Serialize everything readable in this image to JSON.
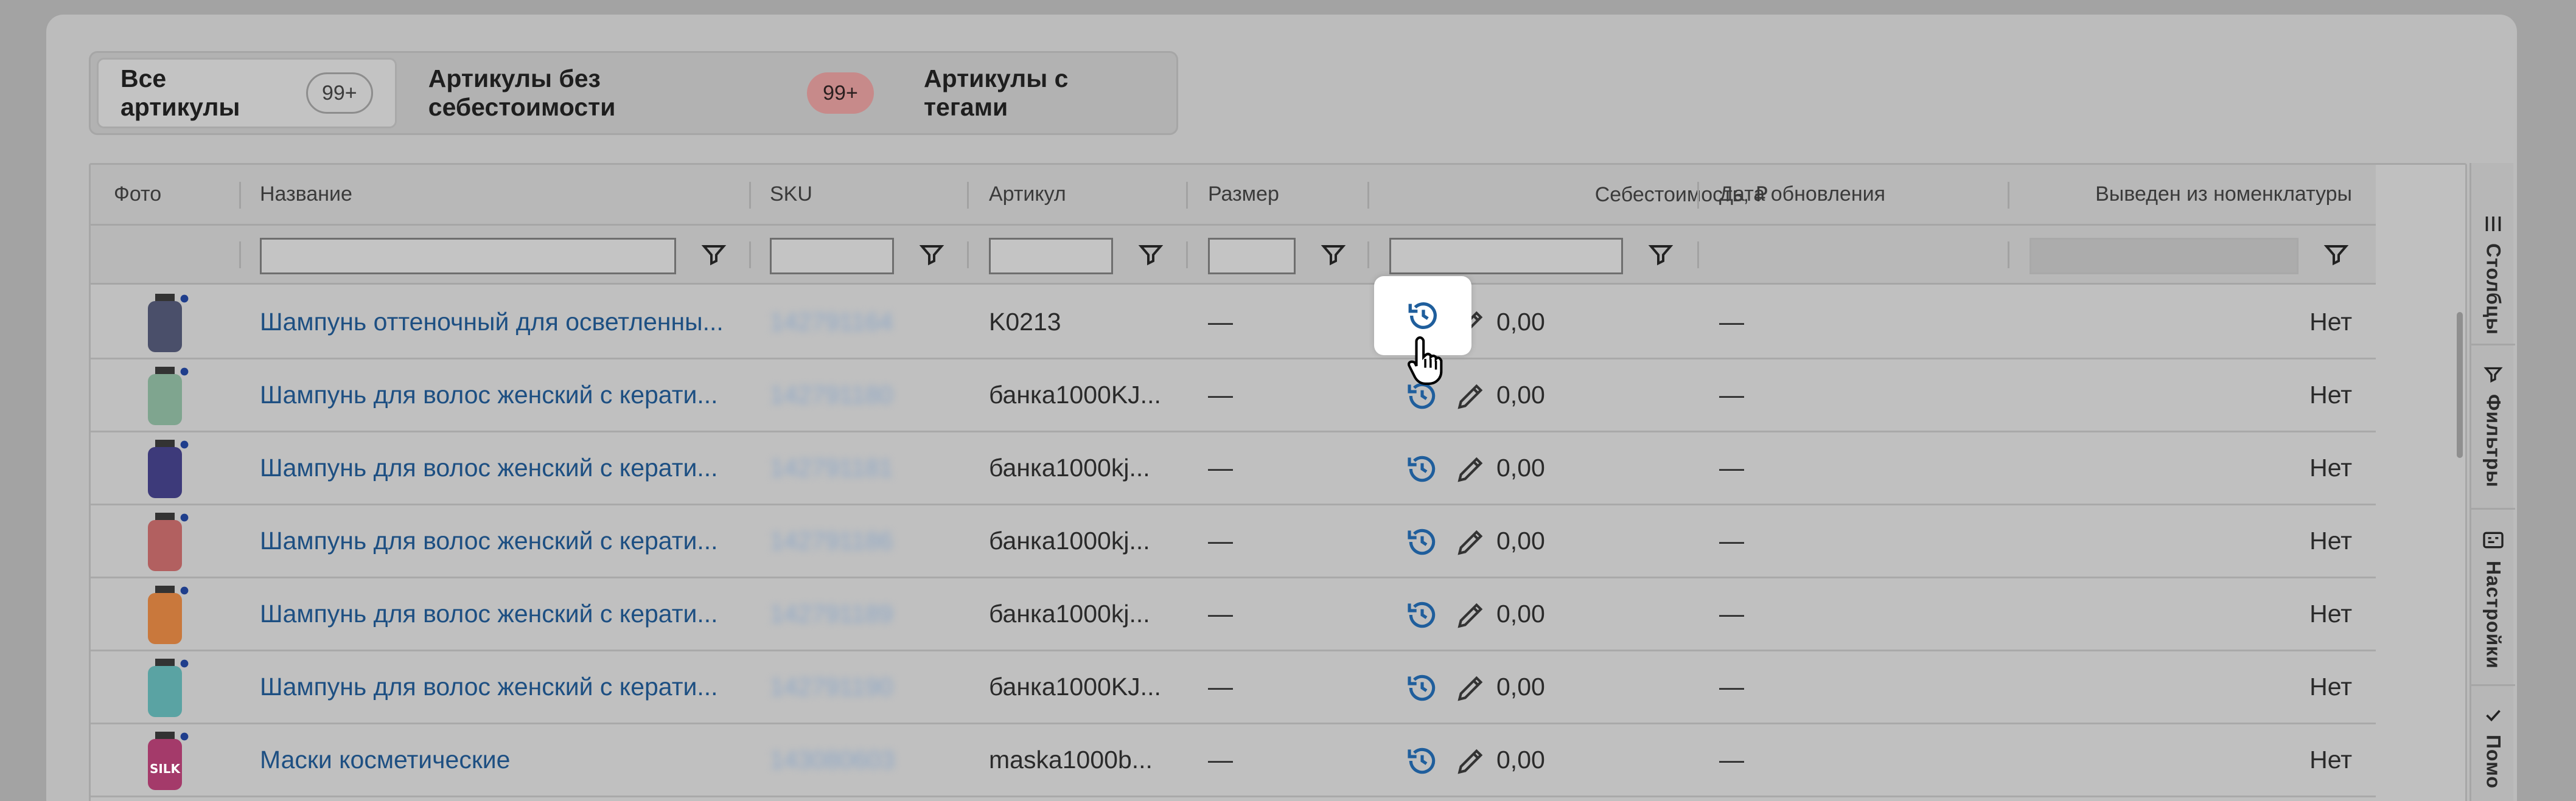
{
  "tabs": [
    {
      "label": "Все артикулы",
      "badge": "99+"
    },
    {
      "label": "Артикулы без себестоимости",
      "badge": "99+"
    },
    {
      "label": "Артикулы с тегами"
    }
  ],
  "columns": {
    "photo": "Фото",
    "name": "Название",
    "sku": "SKU",
    "article": "Артикул",
    "size": "Размер",
    "cost": "Себестоимость, ₽",
    "updated": "Дата обновления",
    "excluded": "Выведен из номенклатуры"
  },
  "rows": [
    {
      "name": "Шампунь оттеночный для осветленны...",
      "sku": "142791164",
      "article": "K0213",
      "size": "—",
      "cost": "0,00",
      "updated": "—",
      "excluded": "Нет",
      "thumb_color": "#4a4f6a"
    },
    {
      "name": "Шампунь для волос женский с керати...",
      "sku": "142791180",
      "article": "банка1000KJ...",
      "size": "—",
      "cost": "0,00",
      "updated": "—",
      "excluded": "Нет",
      "thumb_color": "#7fa58f"
    },
    {
      "name": "Шампунь для волос женский с керати...",
      "sku": "142791181",
      "article": "банка1000kj...",
      "size": "—",
      "cost": "0,00",
      "updated": "—",
      "excluded": "Нет",
      "thumb_color": "#3d3a7a"
    },
    {
      "name": "Шампунь для волос женский с керати...",
      "sku": "142791186",
      "article": "банка1000kj...",
      "size": "—",
      "cost": "0,00",
      "updated": "—",
      "excluded": "Нет",
      "thumb_color": "#b26060"
    },
    {
      "name": "Шампунь для волос женский с керати...",
      "sku": "142791189",
      "article": "банка1000kj...",
      "size": "—",
      "cost": "0,00",
      "updated": "—",
      "excluded": "Нет",
      "thumb_color": "#c9783c"
    },
    {
      "name": "Шампунь для волос женский с керати...",
      "sku": "142791190",
      "article": "банка1000KJ...",
      "size": "—",
      "cost": "0,00",
      "updated": "—",
      "excluded": "Нет",
      "thumb_color": "#5aa3a3"
    },
    {
      "name": "Маски косметические",
      "sku": "143080603",
      "article": "maska1000b...",
      "size": "—",
      "cost": "0,00",
      "updated": "—",
      "excluded": "Нет",
      "thumb_color": "#a43a6a",
      "thumb_text": "SILK"
    }
  ],
  "side_panel": [
    {
      "label": "Столбцы",
      "icon": "columns-icon"
    },
    {
      "label": "Фильтры",
      "icon": "filter-icon"
    },
    {
      "label": "Настройки",
      "icon": "settings-icon"
    },
    {
      "label": "Помо",
      "icon": "check-icon"
    }
  ],
  "colors": {
    "link": "#1d4f82",
    "badge_red": "#c78a8a",
    "history_icon": "#1f5e9c"
  }
}
